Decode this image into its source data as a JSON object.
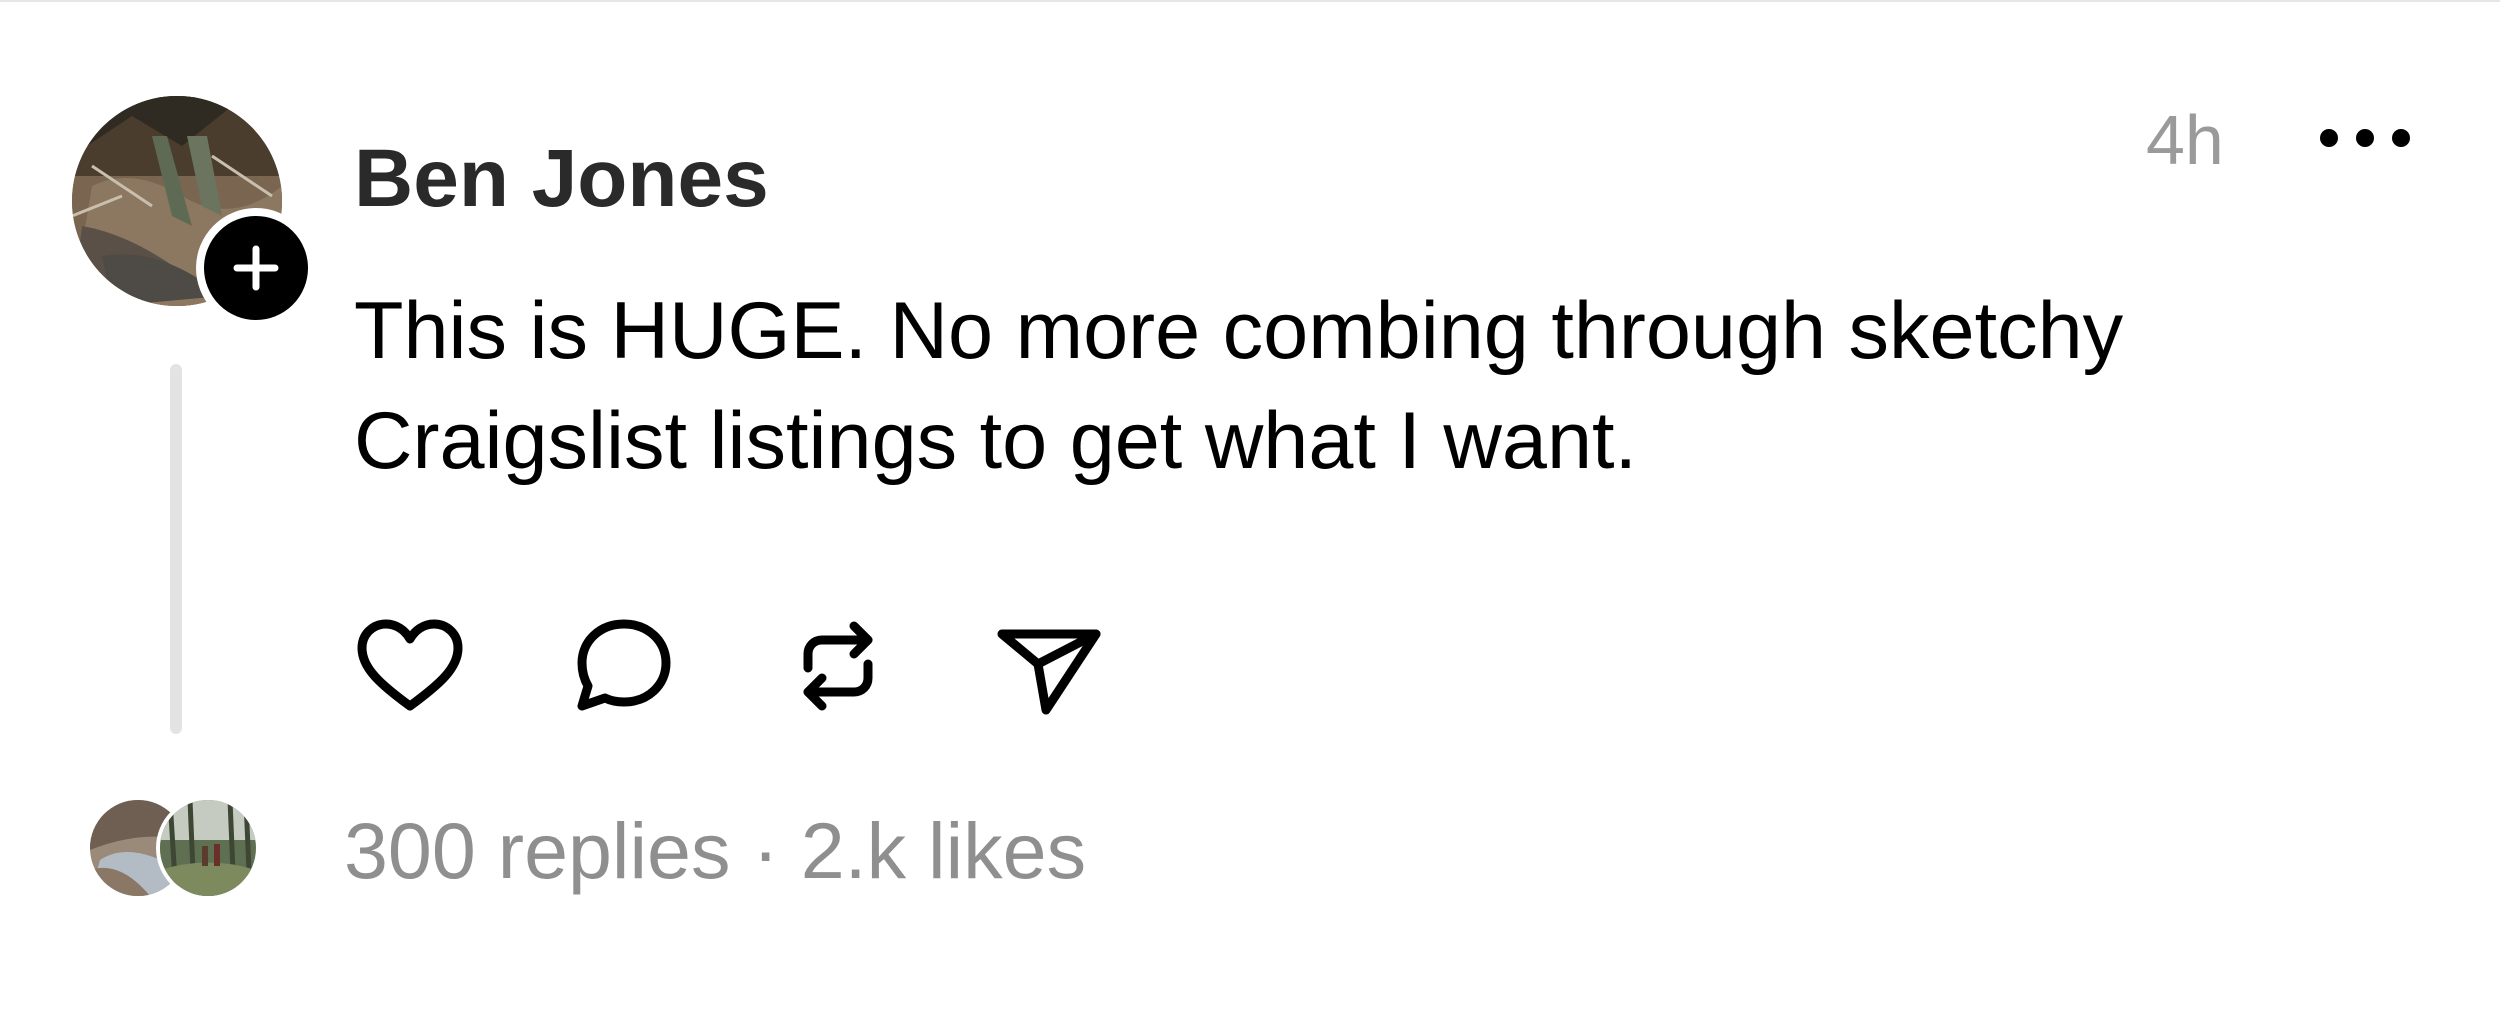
{
  "post": {
    "author": "Ben Jones",
    "timestamp": "4h",
    "text_lines": [
      "This is HUGE. No more combing through sketchy",
      "Craigslist listings to get what I want."
    ],
    "replies": "300 replies",
    "separator": "·",
    "likes": "2.k likes"
  },
  "icons": {
    "like": "heart-icon",
    "reply": "speech-bubble-icon",
    "repost": "repost-arrows-icon",
    "share": "paper-plane-icon",
    "more": "ellipsis-icon",
    "follow": "plus-icon"
  },
  "colors": {
    "text": "#000000",
    "author": "#2a2a2a",
    "muted": "#8f8f8f",
    "thread_line": "#e3e3e3"
  }
}
